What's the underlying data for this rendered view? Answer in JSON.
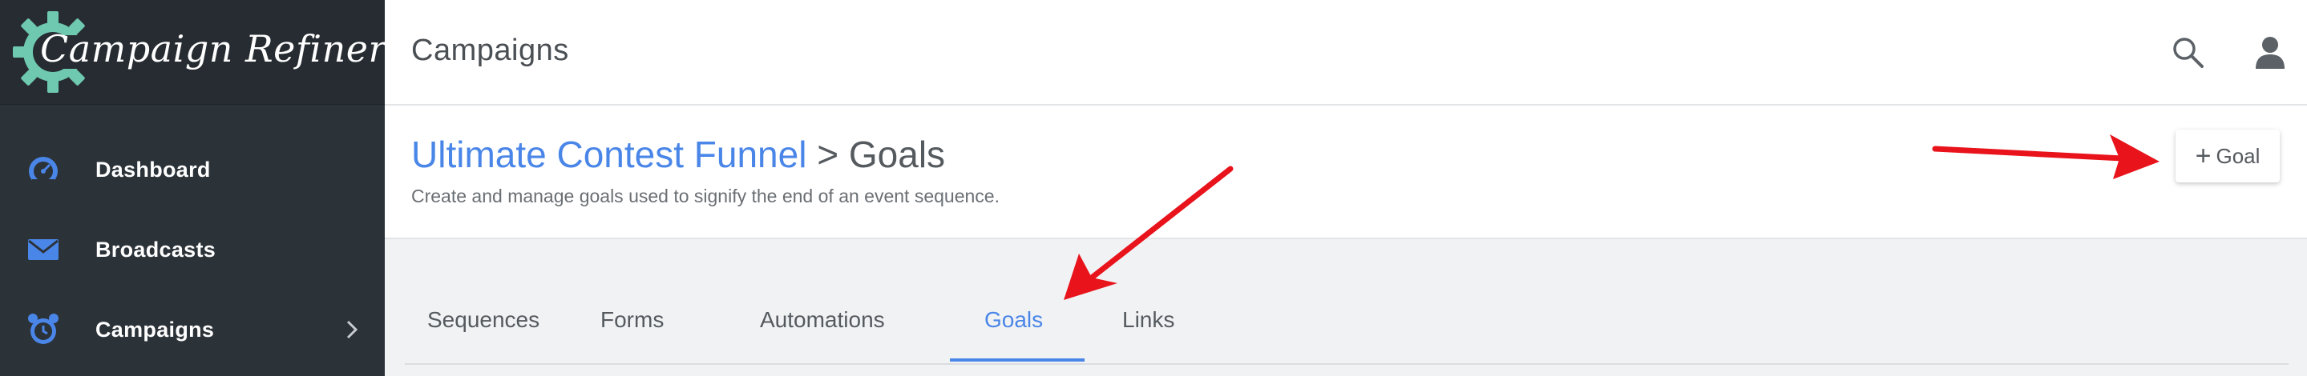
{
  "app": {
    "brand_name": "Campaign Refinery"
  },
  "sidebar": {
    "items": [
      {
        "label": "Dashboard",
        "icon": "speedometer-icon"
      },
      {
        "label": "Broadcasts",
        "icon": "envelope-icon"
      },
      {
        "label": "Campaigns",
        "icon": "alarm-clock-icon",
        "has_submenu": true
      }
    ]
  },
  "topbar": {
    "title": "Campaigns",
    "icons": [
      "search-icon",
      "user-icon"
    ]
  },
  "page_header": {
    "breadcrumb_link": "Ultimate Contest Funnel",
    "breadcrumb_separator": ">",
    "breadcrumb_current": "Goals",
    "description": "Create and manage goals used to signify the end of an event sequence.",
    "add_button_plus": "+",
    "add_button_label": "Goal"
  },
  "tabs": [
    {
      "label": "Sequences",
      "active": false
    },
    {
      "label": "Forms",
      "active": false
    },
    {
      "label": "Automations",
      "active": false
    },
    {
      "label": "Goals",
      "active": true
    },
    {
      "label": "Links",
      "active": false
    }
  ],
  "colors": {
    "sidebar_bg": "#2b3238",
    "accent_blue": "#4a86e8",
    "logo_teal": "#6fc9b1",
    "annotation_red": "#e8131b"
  }
}
